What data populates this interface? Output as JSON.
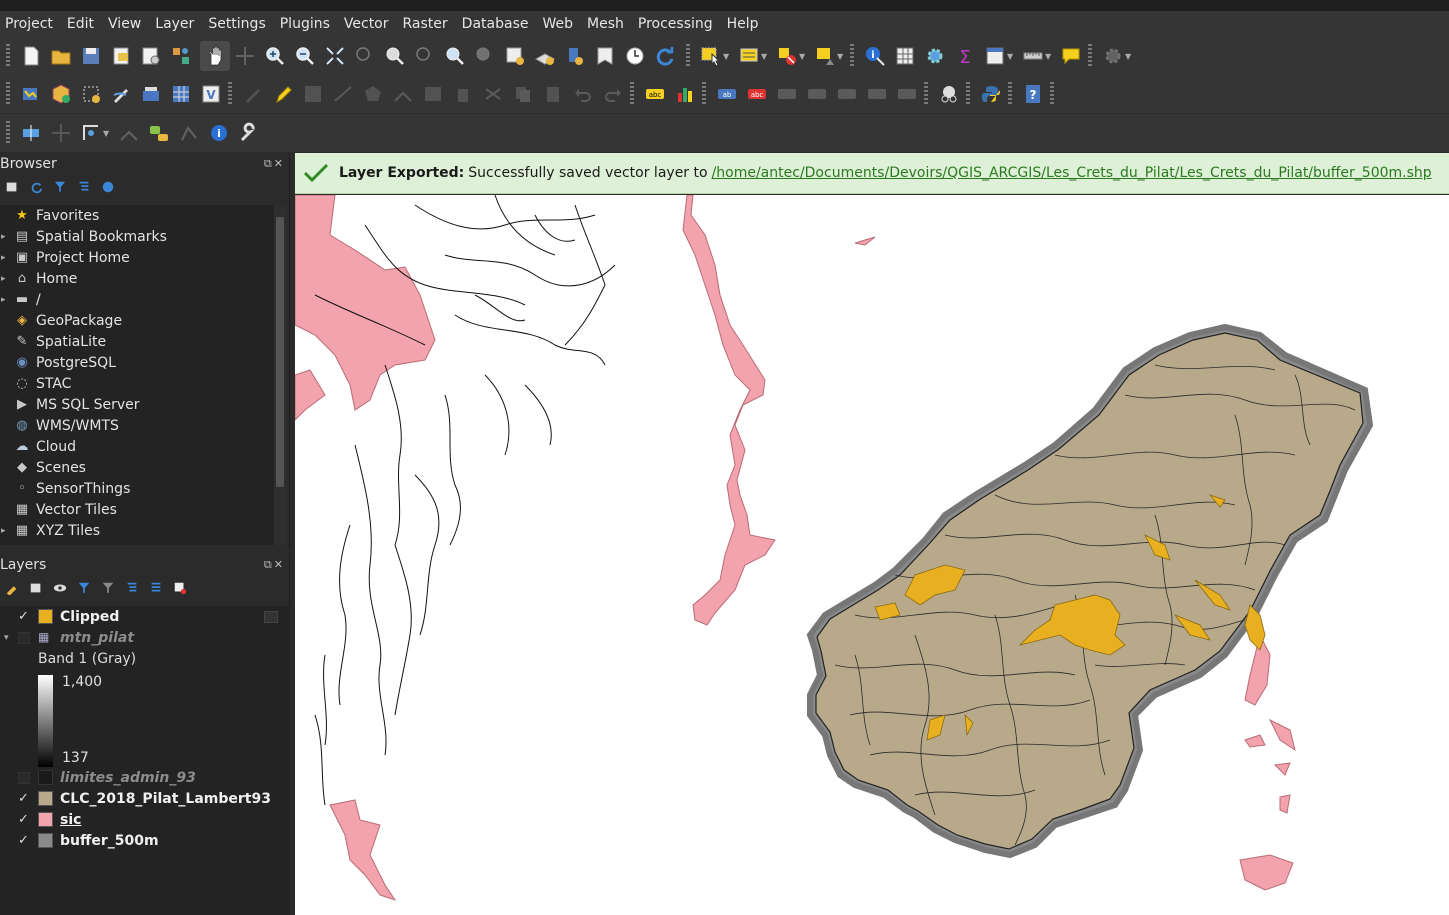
{
  "menu": [
    "Project",
    "Edit",
    "View",
    "Layer",
    "Settings",
    "Plugins",
    "Vector",
    "Raster",
    "Database",
    "Web",
    "Mesh",
    "Processing",
    "Help"
  ],
  "browser": {
    "title": "Browser",
    "items": [
      {
        "label": "Favorites",
        "icon": "star-icon",
        "expand": false
      },
      {
        "label": "Spatial Bookmarks",
        "icon": "bookmark-icon",
        "expand": true
      },
      {
        "label": "Project Home",
        "icon": "project-home-icon",
        "expand": true
      },
      {
        "label": "Home",
        "icon": "home-icon",
        "expand": true
      },
      {
        "label": "/",
        "icon": "folder-icon",
        "expand": true
      },
      {
        "label": "GeoPackage",
        "icon": "geopackage-icon",
        "expand": false
      },
      {
        "label": "SpatiaLite",
        "icon": "spatialite-icon",
        "expand": false
      },
      {
        "label": "PostgreSQL",
        "icon": "postgresql-icon",
        "expand": false
      },
      {
        "label": "STAC",
        "icon": "stac-icon",
        "expand": false
      },
      {
        "label": "MS SQL Server",
        "icon": "mssql-icon",
        "expand": false
      },
      {
        "label": "WMS/WMTS",
        "icon": "wms-icon",
        "expand": false
      },
      {
        "label": "Cloud",
        "icon": "cloud-icon",
        "expand": false
      },
      {
        "label": "Scenes",
        "icon": "scenes-icon",
        "expand": false
      },
      {
        "label": "SensorThings",
        "icon": "sensorthings-icon",
        "expand": false
      },
      {
        "label": "Vector Tiles",
        "icon": "vector-tiles-icon",
        "expand": false
      },
      {
        "label": "XYZ Tiles",
        "icon": "xyz-tiles-icon",
        "expand": true
      }
    ]
  },
  "layers": {
    "title": "Layers",
    "items": [
      {
        "label": "Clipped",
        "checked": true,
        "color": "#e8b021",
        "style": "bold"
      },
      {
        "label": "mtn_pilat",
        "checked": false,
        "color": "raster",
        "style": "italic"
      },
      {
        "label": "Band 1 (Gray)",
        "style": "plain"
      },
      {
        "label": "limites_admin_93",
        "checked": false,
        "color": "#1a1a1a",
        "style": "italic"
      },
      {
        "label": "CLC_2018_Pilat_Lambert93",
        "checked": true,
        "color": "#b8a98a",
        "style": "bold"
      },
      {
        "label": "sic",
        "checked": true,
        "color": "#f2a3ad",
        "style": "bold"
      },
      {
        "label": "buffer_500m",
        "checked": true,
        "color": "#8a8a8a",
        "style": "bold"
      }
    ],
    "gradient_max": "1,400",
    "gradient_min": "137"
  },
  "message": {
    "title": "Layer Exported:",
    "text": "Successfully saved vector layer to",
    "link": "/home/antec/Documents/Devoirs/QGIS_ARCGIS/Les_Crets_du_Pilat/Les_Crets_du_Pilat/buffer_500m.shp"
  },
  "colors": {
    "clc_fill": "#b8a98a",
    "buffer": "#8a8a8a",
    "sic_fill": "#f2a3ad",
    "clipped": "#e8b021"
  }
}
